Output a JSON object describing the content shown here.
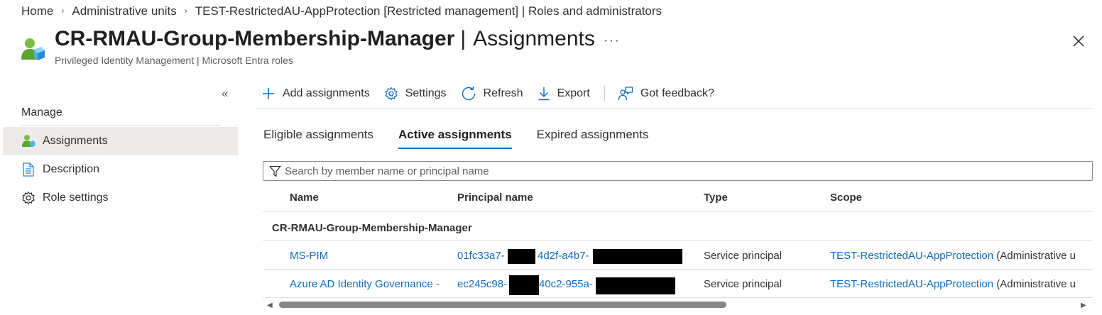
{
  "breadcrumb": {
    "items": [
      "Home",
      "Administrative units",
      "TEST-RestrictedAU-AppProtection [Restricted management] | Roles and administrators"
    ]
  },
  "header": {
    "title_strong": "CR-RMAU-Group-Membership-Manager",
    "title_separator": "|",
    "title_light": "Assignments",
    "subtitle": "Privileged Identity Management | Microsoft Entra roles",
    "more_label": "···",
    "close_icon": "close-icon"
  },
  "sidebar": {
    "collapse_label": "«",
    "section_title": "Manage",
    "items": [
      {
        "label": "Assignments",
        "icon": "assignments-icon",
        "selected": true
      },
      {
        "label": "Description",
        "icon": "description-icon",
        "selected": false
      },
      {
        "label": "Role settings",
        "icon": "gear-icon",
        "selected": false
      }
    ]
  },
  "toolbar": {
    "add_label": "Add assignments",
    "settings_label": "Settings",
    "refresh_label": "Refresh",
    "export_label": "Export",
    "feedback_label": "Got feedback?"
  },
  "tabs": [
    {
      "label": "Eligible assignments",
      "active": false
    },
    {
      "label": "Active assignments",
      "active": true
    },
    {
      "label": "Expired assignments",
      "active": false
    }
  ],
  "search": {
    "placeholder": "Search by member name or principal name",
    "value": ""
  },
  "table": {
    "columns": [
      "Name",
      "Principal name",
      "Type",
      "Scope"
    ],
    "group": "CR-RMAU-Group-Membership-Manager",
    "rows": [
      {
        "name": "MS-PIM",
        "principal_a": "01fc33a7-",
        "principal_b": "4d2f-a4b7-",
        "type": "Service principal",
        "scope_link": "TEST-RestrictedAU-AppProtection",
        "scope_suffix": " (Administrative u"
      },
      {
        "name": "Azure AD Identity Governance -",
        "principal_a": "ec245c98-",
        "principal_b": "40c2-955a-",
        "type": "Service principal",
        "scope_link": "TEST-RestrictedAU-AppProtection",
        "scope_suffix": " (Administrative u"
      }
    ]
  },
  "colors": {
    "link": "#0f6cbd",
    "accent": "#0f6cbd",
    "selected_bg": "#edebe9",
    "redaction": "#000000"
  }
}
